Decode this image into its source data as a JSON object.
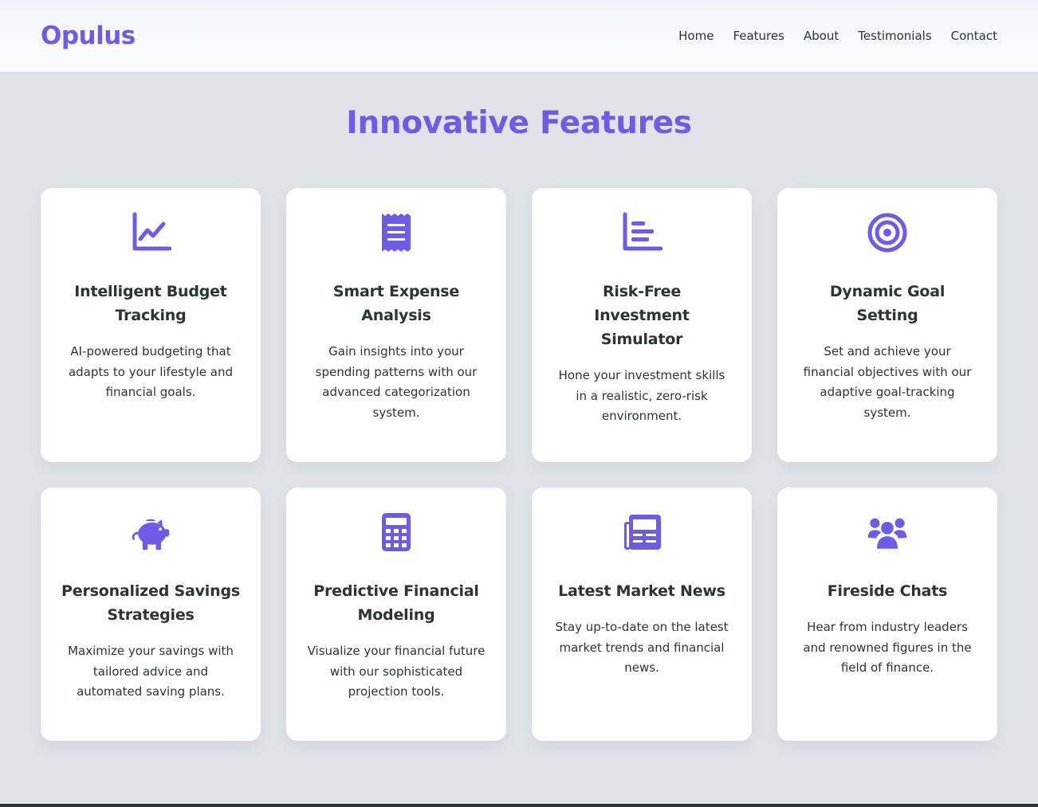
{
  "brand": {
    "name": "Opulus",
    "accent_color": "#6c5ce7",
    "text_color": "#2d3436"
  },
  "nav": {
    "items": [
      {
        "label": "Home"
      },
      {
        "label": "Features"
      },
      {
        "label": "About"
      },
      {
        "label": "Testimonials"
      },
      {
        "label": "Contact"
      }
    ]
  },
  "features": {
    "title": "Innovative Features",
    "cards": [
      {
        "icon": "chart-line-icon",
        "title": "Intelligent Budget Tracking",
        "description": "AI-powered budgeting that adapts to your lifestyle and financial goals."
      },
      {
        "icon": "receipt-icon",
        "title": "Smart Expense Analysis",
        "description": "Gain insights into your spending patterns with our advanced categorization system."
      },
      {
        "icon": "chart-bar-icon",
        "title": "Risk-Free Investment Simulator",
        "description": "Hone your investment skills in a realistic, zero-risk environment."
      },
      {
        "icon": "bullseye-icon",
        "title": "Dynamic Goal Setting",
        "description": "Set and achieve your financial objectives with our adaptive goal-tracking system."
      },
      {
        "icon": "piggy-bank-icon",
        "title": "Personalized Savings Strategies",
        "description": "Maximize your savings with tailored advice and automated saving plans."
      },
      {
        "icon": "calculator-icon",
        "title": "Predictive Financial Modeling",
        "description": "Visualize your financial future with our sophisticated projection tools."
      },
      {
        "icon": "newspaper-icon",
        "title": "Latest Market News",
        "description": "Stay up-to-date on the latest market trends and financial news."
      },
      {
        "icon": "users-icon",
        "title": "Fireside Chats",
        "description": "Hear from industry leaders and renowned figures in the field of finance."
      }
    ]
  }
}
